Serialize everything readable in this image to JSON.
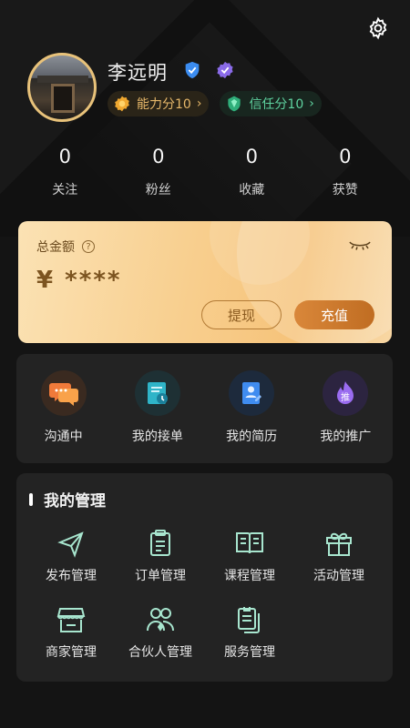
{
  "profile": {
    "name": "李远明",
    "ability_chip": "能力分10",
    "trust_chip": "信任分10",
    "chip_arrow": "›"
  },
  "stats": [
    {
      "value": "0",
      "label": "关注"
    },
    {
      "value": "0",
      "label": "粉丝"
    },
    {
      "value": "0",
      "label": "收藏"
    },
    {
      "value": "0",
      "label": "获赞"
    }
  ],
  "wallet": {
    "title": "总金额",
    "help": "?",
    "amount": "¥ ****",
    "withdraw_label": "提现",
    "recharge_label": "充值"
  },
  "quick_actions": [
    {
      "label": "沟通中",
      "icon": "chat-icon"
    },
    {
      "label": "我的接单",
      "icon": "orders-received-icon"
    },
    {
      "label": "我的简历",
      "icon": "resume-icon"
    },
    {
      "label": "我的推广",
      "icon": "promotion-icon",
      "badge": "推"
    }
  ],
  "management": {
    "title": "我的管理",
    "items": [
      {
        "label": "发布管理",
        "icon": "send-icon"
      },
      {
        "label": "订单管理",
        "icon": "clipboard-icon"
      },
      {
        "label": "课程管理",
        "icon": "book-icon"
      },
      {
        "label": "活动管理",
        "icon": "gift-icon"
      },
      {
        "label": "商家管理",
        "icon": "store-icon"
      },
      {
        "label": "合伙人管理",
        "icon": "partners-icon"
      },
      {
        "label": "服务管理",
        "icon": "service-docs-icon"
      }
    ]
  },
  "colors": {
    "accent_gold": "#e7b86a",
    "accent_green": "#5fd3a0",
    "icon_mint": "#a8e6cf",
    "background": "#141414",
    "card": "#232323"
  }
}
